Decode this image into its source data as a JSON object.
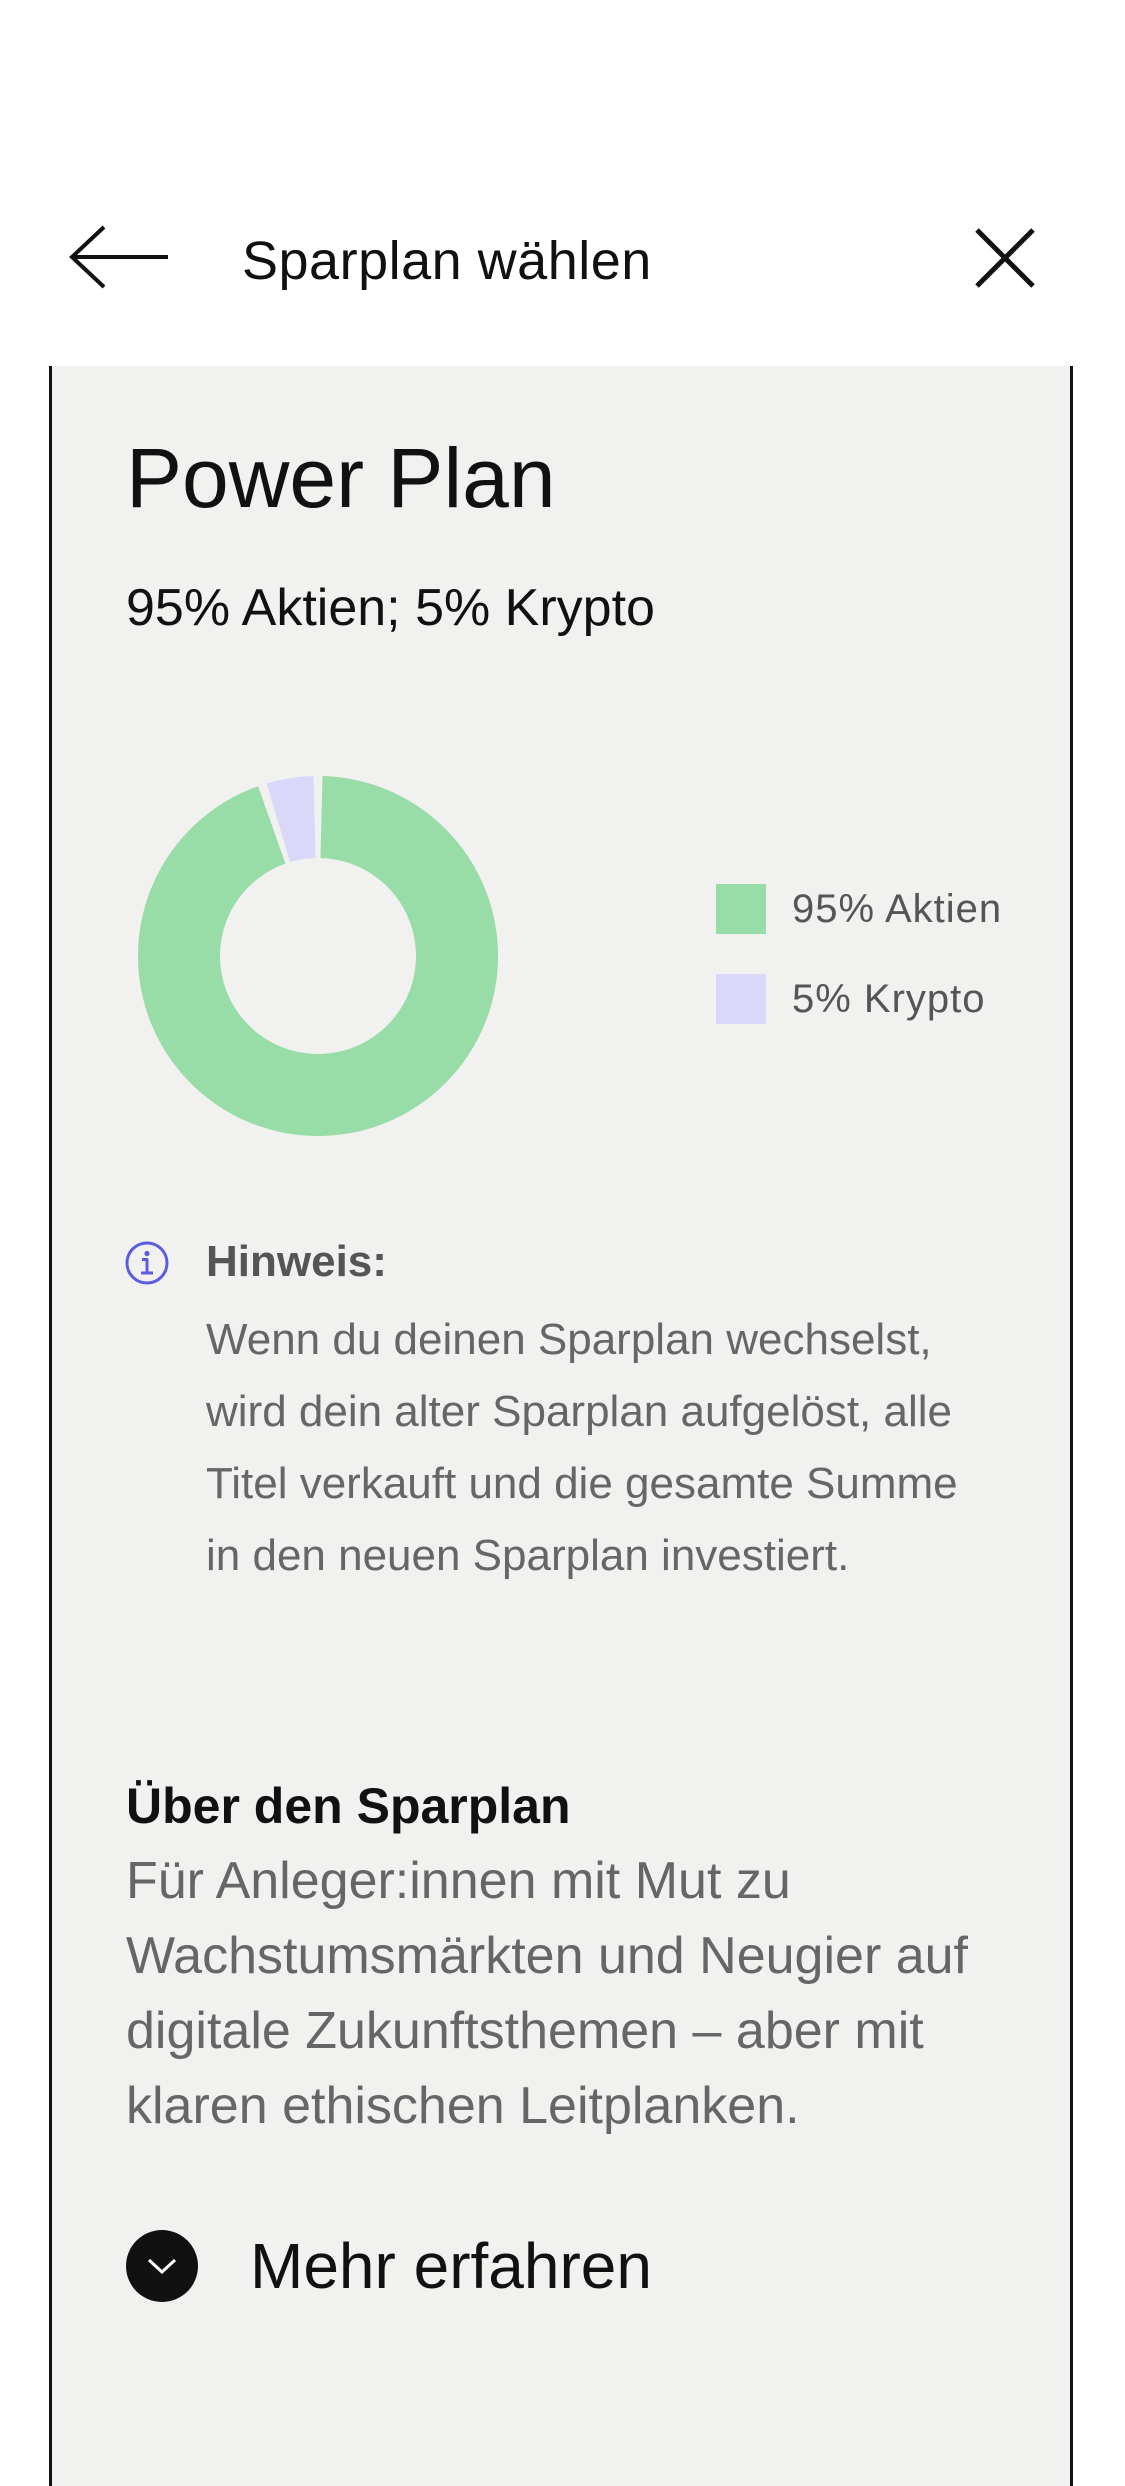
{
  "header": {
    "title": "Sparplan wählen",
    "back_icon": "arrow-left-icon",
    "close_icon": "close-icon"
  },
  "plan": {
    "name": "Power Plan",
    "allocation": "95% Aktien; 5% Krypto"
  },
  "chart_data": {
    "type": "pie",
    "donut": true,
    "title": "",
    "categories": [
      "95% Aktien",
      "5% Krypto"
    ],
    "values": [
      95,
      5
    ],
    "colors": [
      "#98dca8",
      "#d9d8f9"
    ],
    "legend_position": "right"
  },
  "legend": {
    "items": [
      {
        "label": "95% Aktien",
        "color": "#98dca8"
      },
      {
        "label": "5% Krypto",
        "color": "#d9d8f9"
      }
    ]
  },
  "hint": {
    "icon": "info-icon",
    "title": "Hinweis:",
    "text": "Wenn du deinen Sparplan wechselst, wird dein alter Sparplan aufgelöst, alle Titel verkauft und die gesamte Summe in den neuen Sparplan investiert."
  },
  "about": {
    "title": "Über den Sparplan",
    "text": "Für Anleger:innen mit Mut zu Wachstumsmärkten und Neugier auf digitale Zukunftsthemen – aber mit klaren ethischen Leitplanken."
  },
  "more": {
    "label": "Mehr erfahren",
    "icon": "chevron-down-icon"
  },
  "colors": {
    "card_background": "#f1f1f0",
    "info_accent": "#5c5ce0",
    "text_primary": "#111111",
    "text_secondary": "#666666"
  }
}
